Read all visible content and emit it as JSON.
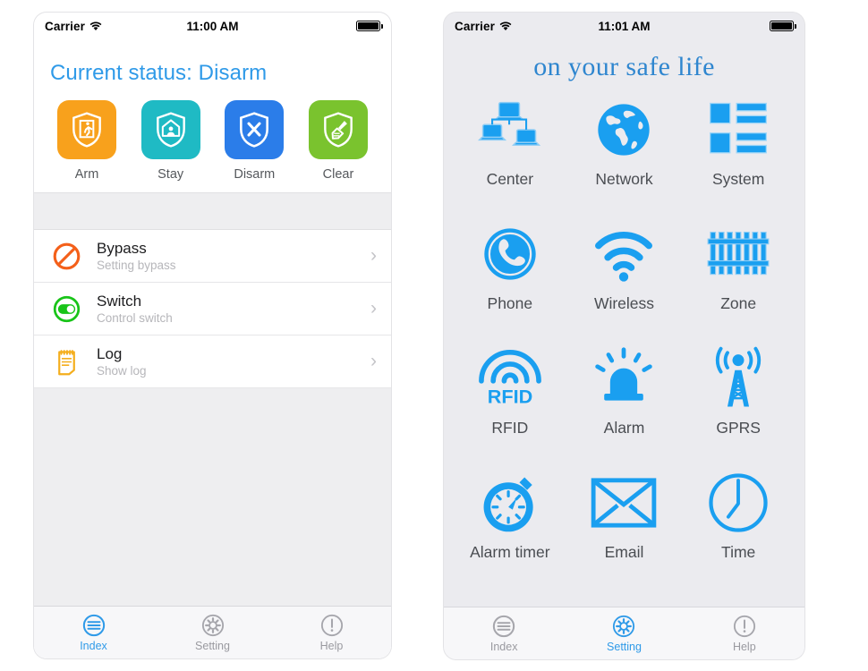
{
  "accent_blue": "#2f9ae8",
  "icon_blue": "#1a9ff0",
  "phones": {
    "left": {
      "status_bar": {
        "carrier": "Carrier",
        "time": "11:00 AM",
        "wifi_icon": "wifi-icon",
        "battery_icon": "battery-full-icon"
      },
      "page_title": "Current status: Disarm",
      "actions": [
        {
          "label": "Arm",
          "icon": "shield-exit-person-icon",
          "color": "#f8a11c"
        },
        {
          "label": "Stay",
          "icon": "shield-home-person-icon",
          "color": "#1fbac4"
        },
        {
          "label": "Disarm",
          "icon": "shield-x-icon",
          "color": "#2b7de9"
        },
        {
          "label": "Clear",
          "icon": "shield-brush-icon",
          "color": "#7ac32e"
        }
      ],
      "list": [
        {
          "title": "Bypass",
          "subtitle": "Setting bypass",
          "icon": "prohibition-icon",
          "color": "#f4601a",
          "chevron": "›"
        },
        {
          "title": "Switch",
          "subtitle": "Control switch",
          "icon": "toggle-on-icon",
          "color": "#19c419",
          "chevron": "›"
        },
        {
          "title": "Log",
          "subtitle": "Show log",
          "icon": "notepad-icon",
          "color": "#f4ae1d",
          "chevron": "›"
        }
      ],
      "tabs": [
        {
          "label": "Index",
          "icon": "index-lines-circle-icon",
          "active": true
        },
        {
          "label": "Setting",
          "icon": "gear-icon",
          "active": false
        },
        {
          "label": "Help",
          "icon": "exclamation-circle-icon",
          "active": false
        }
      ]
    },
    "right": {
      "status_bar": {
        "carrier": "Carrier",
        "time": "11:01 AM",
        "wifi_icon": "wifi-icon",
        "battery_icon": "battery-full-icon"
      },
      "tagline": "on your safe life",
      "grid": [
        {
          "label": "Center",
          "icon": "network-computers-icon"
        },
        {
          "label": "Network",
          "icon": "globe-icon"
        },
        {
          "label": "System",
          "icon": "list-blocks-icon"
        },
        {
          "label": "Phone",
          "icon": "phone-handset-circle-icon"
        },
        {
          "label": "Wireless",
          "icon": "wifi-signal-icon"
        },
        {
          "label": "Zone",
          "icon": "fence-icon"
        },
        {
          "label": "RFID",
          "icon": "rfid-arcs-icon"
        },
        {
          "label": "Alarm",
          "icon": "siren-beacon-icon"
        },
        {
          "label": "GPRS",
          "icon": "antenna-tower-icon"
        },
        {
          "label": "Alarm timer",
          "icon": "stopwatch-icon"
        },
        {
          "label": "Email",
          "icon": "envelope-icon"
        },
        {
          "label": "Time",
          "icon": "clock-icon"
        }
      ],
      "tabs": [
        {
          "label": "Index",
          "icon": "index-lines-circle-icon",
          "active": false
        },
        {
          "label": "Setting",
          "icon": "gear-icon",
          "active": true
        },
        {
          "label": "Help",
          "icon": "exclamation-circle-icon",
          "active": false
        }
      ]
    }
  }
}
